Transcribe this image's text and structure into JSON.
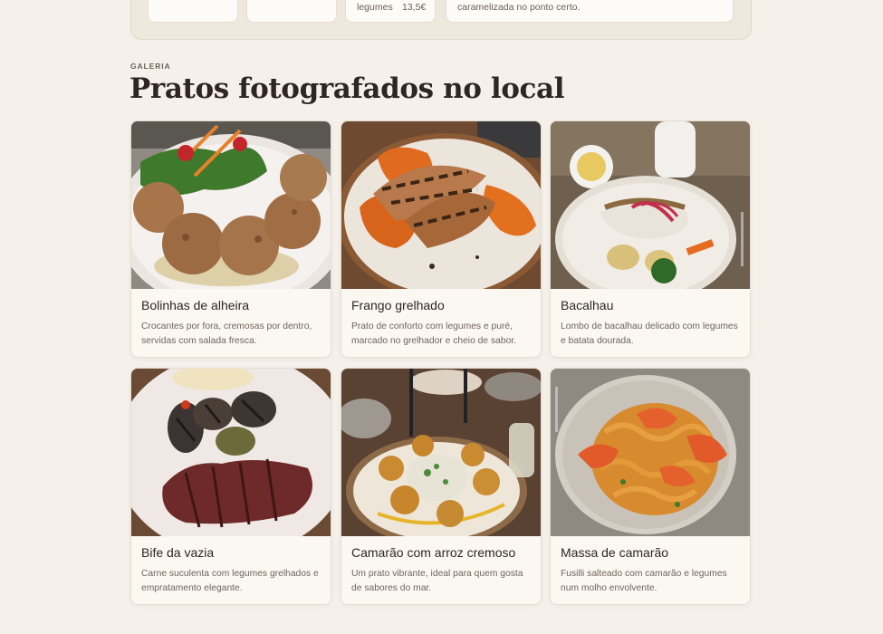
{
  "top_panel": {
    "items": [
      {
        "name": "legumes",
        "price": "13,5€"
      }
    ],
    "note": "caramelizada no ponto certo."
  },
  "gallery": {
    "eyebrow": "GALERIA",
    "title": "Pratos fotografados no local",
    "dishes": [
      {
        "title": "Bolinhas de alheira",
        "description": "Crocantes por fora, cremosas por dentro, servidas com salada fresca."
      },
      {
        "title": "Frango grelhado",
        "description": "Prato de conforto com legumes e puré, marcado no grelhador e cheio de sabor."
      },
      {
        "title": "Bacalhau",
        "description": "Lombo de bacalhau delicado com legumes e batata dourada."
      },
      {
        "title": "Bife da vazia",
        "description": "Carne suculenta com legumes grelhados e empratamento elegante."
      },
      {
        "title": "Camarão com arroz cremoso",
        "description": "Um prato vibrante, ideal para quem gosta de sabores do mar."
      },
      {
        "title": "Massa de camarão",
        "description": "Fusilli salteado com camarão e legumes num molho envolvente."
      }
    ]
  },
  "colors": {
    "background": "#f5f1ea",
    "card": "#fbf8f2",
    "text": "#2f2620",
    "muted": "#6f645a"
  }
}
